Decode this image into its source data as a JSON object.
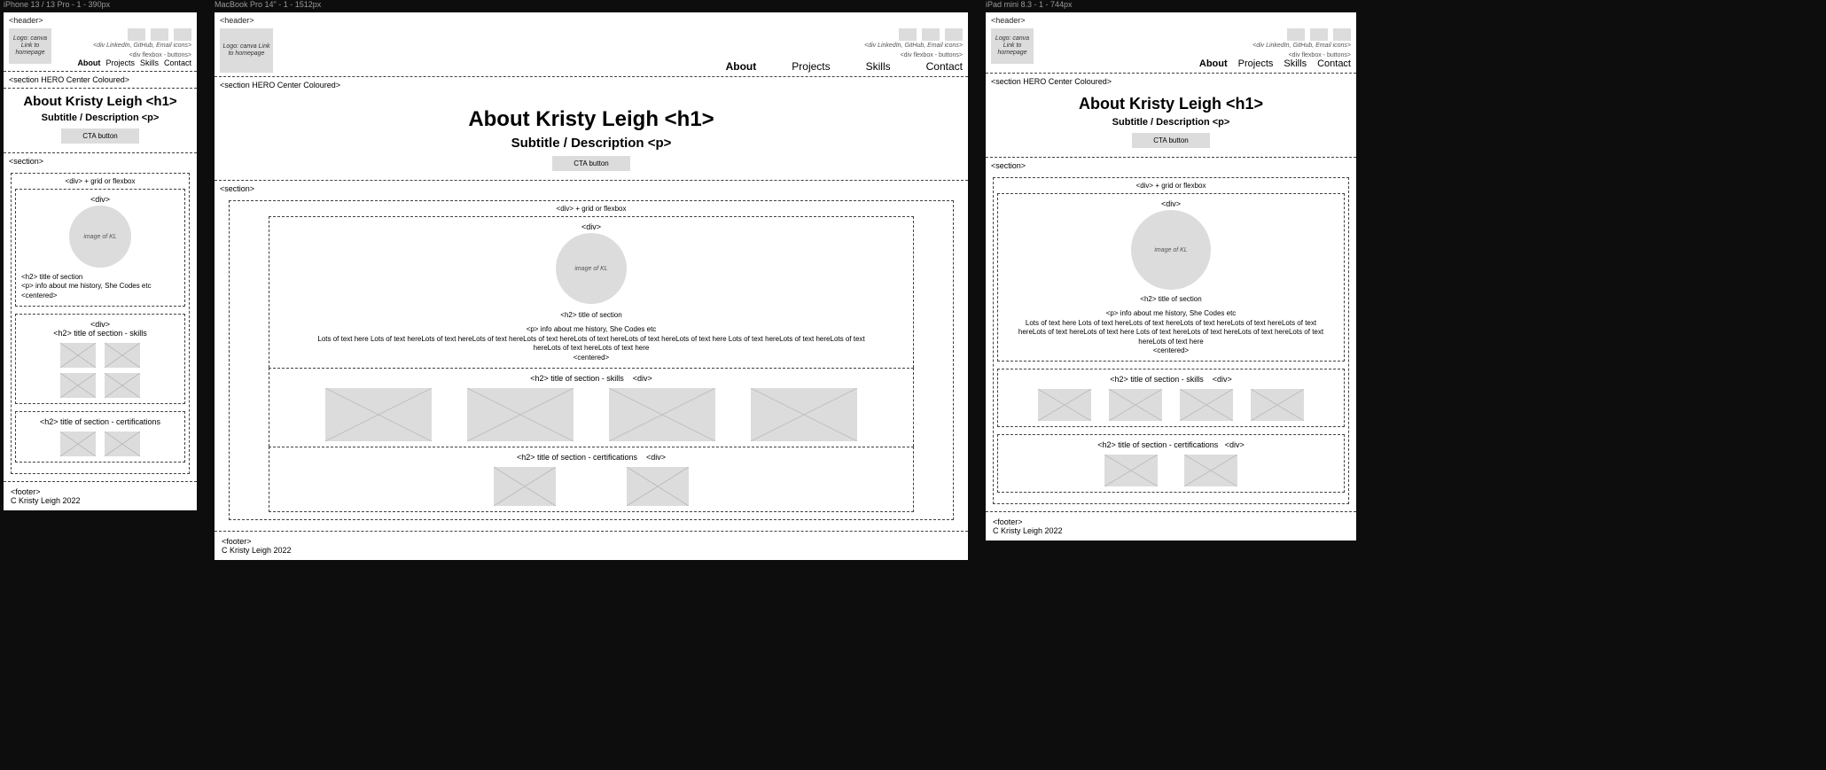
{
  "frames": {
    "iphone": {
      "title": "iPhone 13 / 13 Pro - 1 - 390px"
    },
    "macbook": {
      "title": "MacBook Pro 14\" - 1 - 1512px"
    },
    "ipad": {
      "title": "iPad mini 8.3 - 1 - 744px"
    }
  },
  "header": {
    "tag": "<header>",
    "logo_text": "Logo: canva Link to homepage",
    "social_caption": "<div LinkedIn, GitHub, Email icons>",
    "nav_caption": "<div flexbox - buttons>",
    "nav": {
      "about": "About",
      "projects": "Projects",
      "skills": "Skills",
      "contact": "Contact"
    }
  },
  "hero": {
    "tag": "<section HERO Center Coloured>",
    "h1": "About Kristy Leigh <h1>",
    "subtitle": "Subtitle / Description <p>",
    "cta": "CTA button"
  },
  "section": {
    "tag": "<section>",
    "grid_caption": "<div> + grid or flexbox",
    "div_tag": "<div>",
    "about_card": {
      "image_label": "image of KL",
      "h2": "<h2> title of section",
      "p_label": "<p> info about me history, She Codes etc",
      "centered_label": "<centered>",
      "long_text": "Lots of text here Lots of text hereLots of text hereLots of text hereLots of text hereLots of text hereLots of text hereLots of text here Lots of text hereLots of text hereLots of text hereLots of text hereLots of text here",
      "long_text_ipad": "Lots of text here Lots of text hereLots of text hereLots of text hereLots of text hereLots of text hereLots of text hereLots of text here Lots of text hereLots of text hereLots of text hereLots of text hereLots of text here"
    },
    "skills_card": {
      "h2": "<h2> title of section - skills",
      "div_tag": "<div>"
    },
    "certs_card": {
      "h2": "<h2> title of section - certifications",
      "div_tag": "<div>"
    }
  },
  "footer": {
    "tag": "<footer>",
    "copy": "C Kristy Leigh 2022"
  }
}
